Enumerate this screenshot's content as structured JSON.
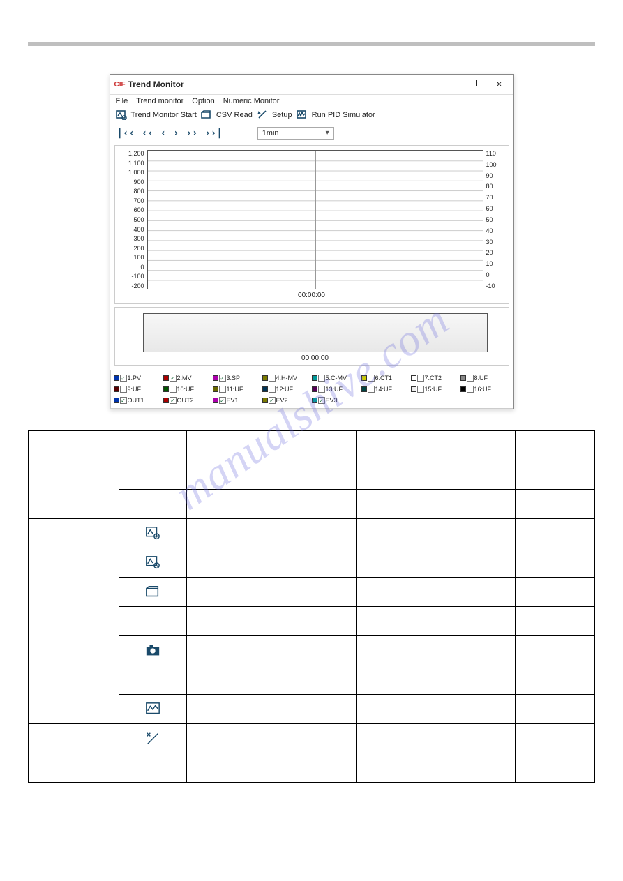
{
  "watermark": "manualshive.com",
  "window": {
    "app_icon": "CIF",
    "title": "Trend Monitor",
    "minimize": "—",
    "close": "✕"
  },
  "menu": {
    "file": "File",
    "trend_monitor": "Trend monitor",
    "option": "Option",
    "numeric_monitor": "Numeric Monitor"
  },
  "toolbar": {
    "trend_monitor_start": "Trend Monitor Start",
    "csv_read": "CSV Read",
    "setup": "Setup",
    "run_pid_simulator": "Run PID Simulator"
  },
  "nav": {
    "first": "|‹‹",
    "prev2": "‹‹",
    "prev": "‹",
    "next": "›",
    "next2": "››",
    "last": "››|",
    "time_range": "1min"
  },
  "chart_data": {
    "type": "line",
    "title": "",
    "y_left_ticks": [
      "1,200",
      "1,100",
      "1,000",
      "900",
      "800",
      "700",
      "600",
      "500",
      "400",
      "300",
      "200",
      "100",
      "0",
      "-100",
      "-200"
    ],
    "y_right_ticks": [
      "110",
      "100",
      "90",
      "80",
      "70",
      "60",
      "50",
      "40",
      "30",
      "20",
      "10",
      "0",
      "-10"
    ],
    "x_label_main": "00:00:00",
    "x_label_mini": "00:00:00",
    "series": [],
    "y_left_range": [
      -200,
      1200
    ],
    "y_right_range": [
      -10,
      110
    ]
  },
  "legend": [
    {
      "id": "1",
      "label": "1:PV",
      "color": "#0033aa",
      "checked": true
    },
    {
      "id": "2",
      "label": "2:MV",
      "color": "#aa0000",
      "checked": true
    },
    {
      "id": "3",
      "label": "3:SP",
      "color": "#aa00aa",
      "checked": true
    },
    {
      "id": "4",
      "label": "4:H-MV",
      "color": "#7a7a00",
      "checked": false
    },
    {
      "id": "5",
      "label": "5:C-MV",
      "color": "#009999",
      "checked": false
    },
    {
      "id": "6",
      "label": "6:CT1",
      "color": "#cccc00",
      "checked": false
    },
    {
      "id": "7",
      "label": "7:CT2",
      "color": "#ffffff",
      "checked": false
    },
    {
      "id": "8",
      "label": "8:UF",
      "color": "#888888",
      "checked": false
    },
    {
      "id": "9",
      "label": "9:UF",
      "color": "#550000",
      "checked": false
    },
    {
      "id": "10",
      "label": "10:UF",
      "color": "#005500",
      "checked": false
    },
    {
      "id": "11",
      "label": "11:UF",
      "color": "#666600",
      "checked": false
    },
    {
      "id": "12",
      "label": "12:UF",
      "color": "#003355",
      "checked": false
    },
    {
      "id": "13",
      "label": "13:UF",
      "color": "#550055",
      "checked": false
    },
    {
      "id": "14",
      "label": "14:UF",
      "color": "#004444",
      "checked": false
    },
    {
      "id": "15",
      "label": "15:UF",
      "color": "#eeeeee",
      "checked": false
    },
    {
      "id": "16",
      "label": "16:UF",
      "color": "#000000",
      "checked": false
    },
    {
      "id": "o1",
      "label": "OUT1",
      "color": "#0033aa",
      "checked": true
    },
    {
      "id": "o2",
      "label": "OUT2",
      "color": "#aa0000",
      "checked": true
    },
    {
      "id": "e1",
      "label": "EV1",
      "color": "#aa00aa",
      "checked": true
    },
    {
      "id": "e2",
      "label": "EV2",
      "color": "#7a7a00",
      "checked": true
    },
    {
      "id": "e3",
      "label": "EV3",
      "color": "#009999",
      "checked": true
    }
  ]
}
